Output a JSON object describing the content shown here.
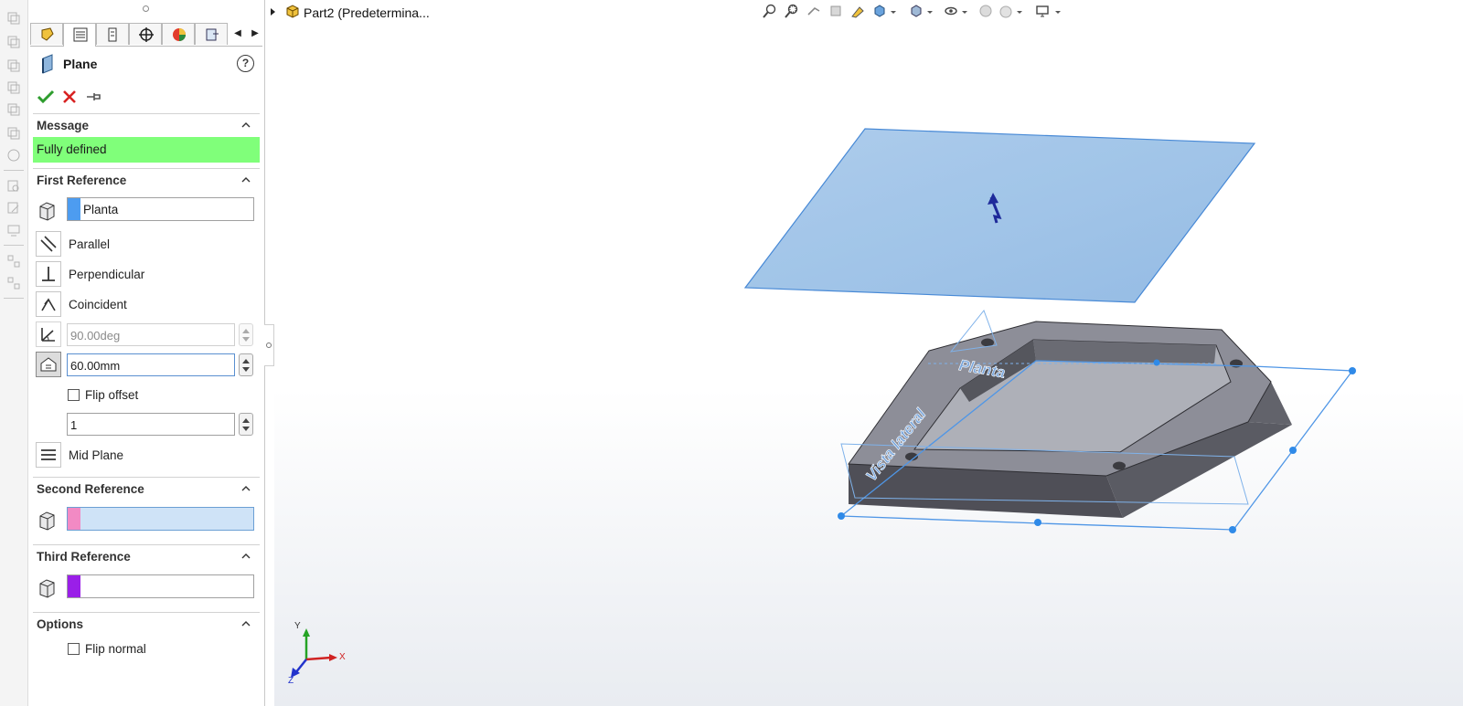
{
  "tree": {
    "label": "Part2 (Predetermina..."
  },
  "pm": {
    "title": "Plane",
    "help": "?",
    "tabs": [
      "feature-manager-icon",
      "property-manager-icon",
      "configuration-manager-icon",
      "dimxpert-manager-icon",
      "display-manager-icon",
      "cam-manager-icon"
    ],
    "message": {
      "header": "Message",
      "text": "Fully defined",
      "color": "#80ff7a"
    },
    "first_reference": {
      "header": "First Reference",
      "selection": "Planta",
      "stripe_color": "#4d9cf0",
      "parallel": "Parallel",
      "perpendicular": "Perpendicular",
      "coincident": "Coincident",
      "angle": "90.00deg",
      "offset": "60.00mm",
      "flip_offset": "Flip offset",
      "instances": "1",
      "mid_plane": "Mid Plane"
    },
    "second_reference": {
      "header": "Second Reference",
      "stripe_color": "#f28ac4"
    },
    "third_reference": {
      "header": "Third Reference",
      "stripe_color": "#9a1fe8"
    },
    "options": {
      "header": "Options",
      "flip_normal": "Flip normal"
    }
  },
  "viewport": {
    "plane_label": "Planta",
    "top_text": "Vista lateral",
    "axes": {
      "x": "X",
      "y": "Y",
      "z": "Z"
    }
  },
  "colors": {
    "plane_fill": "#9cc3e9",
    "plane_edge": "#3e83d4",
    "part_dark": "#4f4f57",
    "part_top": "#8d8e98",
    "accept": "#2e9d2e",
    "cancel": "#d82222"
  }
}
